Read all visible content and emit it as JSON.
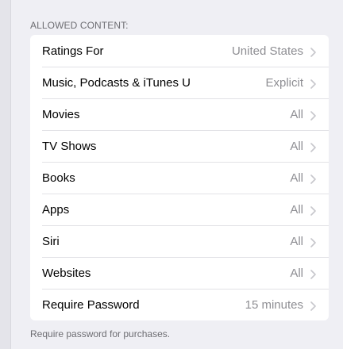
{
  "section": {
    "header": "ALLOWED CONTENT:",
    "footer": "Require password for purchases."
  },
  "rows": [
    {
      "label": "Ratings For",
      "value": "United States"
    },
    {
      "label": "Music, Podcasts & iTunes U",
      "value": "Explicit"
    },
    {
      "label": "Movies",
      "value": "All"
    },
    {
      "label": "TV Shows",
      "value": "All"
    },
    {
      "label": "Books",
      "value": "All"
    },
    {
      "label": "Apps",
      "value": "All"
    },
    {
      "label": "Siri",
      "value": "All"
    },
    {
      "label": "Websites",
      "value": "All"
    },
    {
      "label": "Require Password",
      "value": "15 minutes"
    }
  ],
  "icons": {
    "disclosure": "chevron-right-icon"
  },
  "colors": {
    "background": "#efeff4",
    "cell": "#ffffff",
    "separator": "#e2e2e6",
    "secondary_text": "#8e8e93",
    "section_text": "#6d6d72",
    "chevron": "#c7c7cc"
  }
}
